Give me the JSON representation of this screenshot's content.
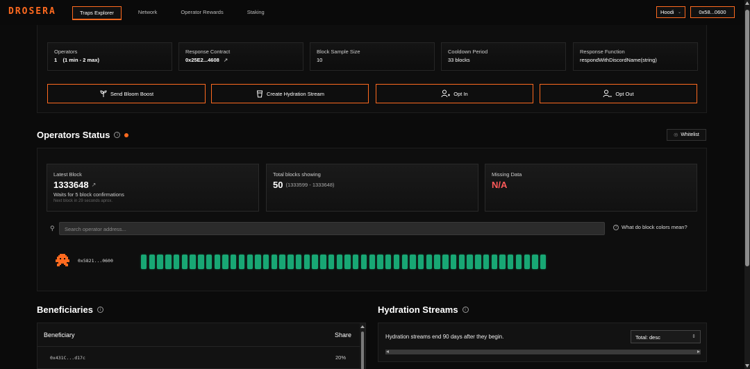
{
  "nav": {
    "logo": "DROSERA",
    "links": [
      "Traps Explorer",
      "Network",
      "Operator Rewards",
      "Staking"
    ],
    "network": "Hoodi",
    "wallet": "0x58...0600"
  },
  "trap": {
    "cards": [
      {
        "label": "Operators",
        "value": "1    (1 min - 2 max)"
      },
      {
        "label": "Response Contract",
        "value": "0x25E2...4608"
      },
      {
        "label": "Block Sample Size",
        "value": "10"
      },
      {
        "label": "Cooldown Period",
        "value": "33 blocks"
      },
      {
        "label": "Response Function",
        "value": "respondWithDiscordName(string)"
      }
    ],
    "actions": [
      {
        "label": "Send Bloom Boost",
        "icon": "sprout-icon"
      },
      {
        "label": "Create Hydration Stream",
        "icon": "cup-icon"
      },
      {
        "label": "Opt In",
        "icon": "user-plus-icon"
      },
      {
        "label": "Opt Out",
        "icon": "user-minus-icon"
      }
    ]
  },
  "operators": {
    "title": "Operators Status",
    "whitelist_label": "Whitelist",
    "latest_block": {
      "label": "Latest Block",
      "value": "1333648",
      "wait": "Waits for 5 block confirmations",
      "next": "Next block in 29 seconds aprox."
    },
    "total_blocks": {
      "label": "Total blocks showing",
      "value": "50",
      "range": "(1333599 - 1333648)"
    },
    "missing": {
      "label": "Missing Data",
      "value": "N/A"
    },
    "search_placeholder": "Search operator address...",
    "color_help": "What do block colors mean?",
    "operator_address": "0x5821...0600",
    "block_count": 50,
    "block_color": "#18a774"
  },
  "beneficiaries": {
    "title": "Beneficiaries",
    "col_beneficiary": "Beneficiary",
    "col_share": "Share",
    "rows": [
      {
        "address": "0x431C...d17c",
        "share": "20%"
      }
    ]
  },
  "hydration": {
    "title": "Hydration Streams",
    "note": "Hydration streams end 90 days after they begin.",
    "sort": "Total: desc"
  },
  "colors": {
    "accent": "#ff6a1f",
    "ok": "#18a774",
    "missing": "#ff5a5a"
  }
}
